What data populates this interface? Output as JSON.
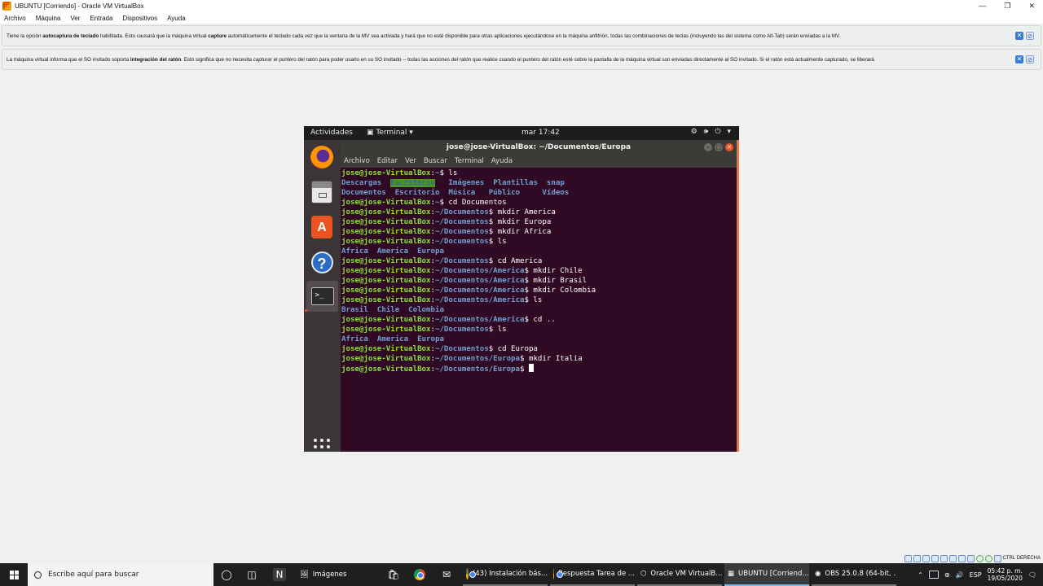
{
  "vbox": {
    "title": "UBUNTU [Corriendo] - Oracle VM VirtualBox",
    "menu": [
      "Archivo",
      "Máquina",
      "Ver",
      "Entrada",
      "Dispositivos",
      "Ayuda"
    ],
    "notice1": {
      "t1": "Tiene la opción ",
      "b1": "autocaptura de teclado",
      "t2": " habilitada. Esto causará que la máquina virtual ",
      "b2": "capture",
      "t3": " automáticamente el teclado cada vez que la ventana de la MV sea activada y hará que no esté disponible para otras aplicaciones ejecutándose en la máquina anfitrión, todas las combinaciones de teclas (incluyendo las del sistema como Alt-Tab) serán enviadas a la MV."
    },
    "notice2": {
      "t1": "La máquina virtual informa que el SO invitado soporta ",
      "b1": "integración del ratón",
      "t2": ". Esto significa que no necesita ",
      "i1": "capturar",
      "t3": " el puntero del ratón para poder usarlo en su SO invitado -- todas las acciones del ratón que realice cuando el puntero del ratón esté sobre la pantalla de la máquina virtual son enviadas directamente al SO invitado. Si el ratón está actualmente capturado, se liberará"
    },
    "host_key": "CTRL DERECHA"
  },
  "guest": {
    "activities": "Actividades",
    "app_menu": "Terminal ▾",
    "clock": "mar 17:42",
    "terminal": {
      "title": "jose@jose-VirtualBox: ~/Documentos/Europa",
      "menu": [
        "Archivo",
        "Editar",
        "Ver",
        "Buscar",
        "Terminal",
        "Ayuda"
      ],
      "user": "jose@jose-VirtualBox",
      "lines": [
        {
          "kind": "prompt",
          "path": "~",
          "cmd": " ls"
        },
        {
          "kind": "ls1"
        },
        {
          "kind": "ls2"
        },
        {
          "kind": "prompt",
          "path": "~",
          "cmd": " cd Documentos"
        },
        {
          "kind": "prompt",
          "path": "~/Documentos",
          "cmd": " mkdir America"
        },
        {
          "kind": "prompt",
          "path": "~/Documentos",
          "cmd": " mkdir Europa"
        },
        {
          "kind": "prompt",
          "path": "~/Documentos",
          "cmd": " mkdir Africa"
        },
        {
          "kind": "prompt",
          "path": "~/Documentos",
          "cmd": " ls"
        },
        {
          "kind": "out",
          "text": "Africa  America  Europa"
        },
        {
          "kind": "prompt",
          "path": "~/Documentos",
          "cmd": " cd America"
        },
        {
          "kind": "prompt",
          "path": "~/Documentos/America",
          "cmd": " mkdir Chile"
        },
        {
          "kind": "prompt",
          "path": "~/Documentos/America",
          "cmd": " mkdir Brasil"
        },
        {
          "kind": "prompt",
          "path": "~/Documentos/America",
          "cmd": " mkdir Colombia"
        },
        {
          "kind": "prompt",
          "path": "~/Documentos/America",
          "cmd": " ls"
        },
        {
          "kind": "out",
          "text": "Brasil  Chile  Colombia"
        },
        {
          "kind": "prompt",
          "path": "~/Documentos/America",
          "cmd": " cd .."
        },
        {
          "kind": "prompt",
          "path": "~/Documentos",
          "cmd": " ls"
        },
        {
          "kind": "out",
          "text": "Africa  America  Europa"
        },
        {
          "kind": "prompt",
          "path": "~/Documentos",
          "cmd": " cd Europa"
        },
        {
          "kind": "prompt",
          "path": "~/Documentos/Europa",
          "cmd": " mkdir Italia"
        },
        {
          "kind": "prompt",
          "path": "~/Documentos/Europa",
          "cmd": " ",
          "cursor": true
        }
      ],
      "ls_row1": [
        "Descargas",
        "Plantillas",
        "snap"
      ],
      "ls_row1_hl": "Escritorio",
      "ls_row1_img": "Imágenes",
      "ls_row2": [
        "Documentos",
        "Escritorio",
        "Música",
        "Público",
        "Vídeos"
      ]
    }
  },
  "taskbar": {
    "search_placeholder": "Escribe aquí para buscar",
    "tasks": [
      "Imágenes",
      "(43) Instalación bás...",
      "Respuesta Tarea de ...",
      "Oracle VM VirtualB...",
      "UBUNTU [Corriend...",
      "OBS 25.0.8 (64-bit, ..."
    ],
    "lang": "ESP",
    "time": "05:42 p. m.",
    "date": "19/05/2020"
  }
}
